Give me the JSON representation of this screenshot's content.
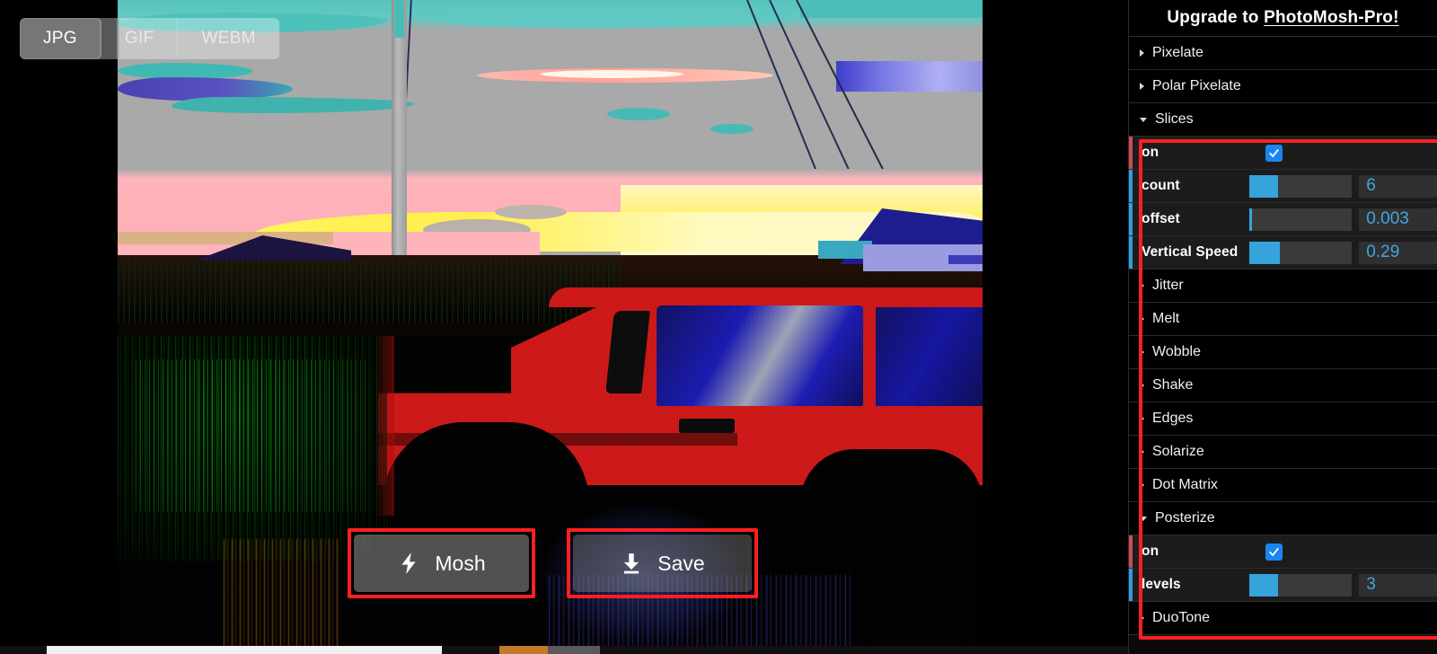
{
  "app": {
    "format_tabs": [
      {
        "label": "JPG",
        "active": true
      },
      {
        "label": "GIF",
        "active": false
      },
      {
        "label": "WEBM",
        "active": false
      }
    ],
    "actions": {
      "mosh": {
        "label": "Mosh",
        "icon": "lightning-bolt-icon"
      },
      "save": {
        "label": "Save",
        "icon": "download-icon"
      }
    }
  },
  "panel": {
    "header": {
      "prefix": "Upgrade to ",
      "link": "PhotoMosh-Pro!"
    },
    "effects": [
      {
        "name": "Pixelate",
        "expanded": false,
        "controls": []
      },
      {
        "name": "Polar Pixelate",
        "expanded": false,
        "controls": []
      },
      {
        "name": "Slices",
        "expanded": true,
        "controls": [
          {
            "type": "toggle",
            "label": "on",
            "checked": true
          },
          {
            "type": "slider",
            "label": "count",
            "value": "6",
            "fill_pct": 28
          },
          {
            "type": "slider",
            "label": "offset",
            "value": "0.003",
            "fill_pct": 3
          },
          {
            "type": "slider",
            "label": "Vertical Speed",
            "value": "0.29",
            "fill_pct": 30
          }
        ]
      },
      {
        "name": "Jitter",
        "expanded": false,
        "controls": []
      },
      {
        "name": "Melt",
        "expanded": false,
        "controls": []
      },
      {
        "name": "Wobble",
        "expanded": false,
        "controls": []
      },
      {
        "name": "Shake",
        "expanded": false,
        "controls": []
      },
      {
        "name": "Edges",
        "expanded": false,
        "controls": []
      },
      {
        "name": "Solarize",
        "expanded": false,
        "controls": []
      },
      {
        "name": "Dot Matrix",
        "expanded": false,
        "controls": []
      },
      {
        "name": "Posterize",
        "expanded": true,
        "controls": [
          {
            "type": "toggle",
            "label": "on",
            "checked": true
          },
          {
            "type": "slider",
            "label": "levels",
            "value": "3",
            "fill_pct": 28
          }
        ]
      },
      {
        "name": "DuoTone",
        "expanded": false,
        "controls": []
      }
    ]
  },
  "colors": {
    "accent_blue": "#36a3dd",
    "checkbox_blue": "#1a86f0",
    "value_text": "#3fa6dd",
    "annotation_red": "#fc2020",
    "panel_bg": "#0a0a0a",
    "row_bg": "#1c1c1c"
  }
}
